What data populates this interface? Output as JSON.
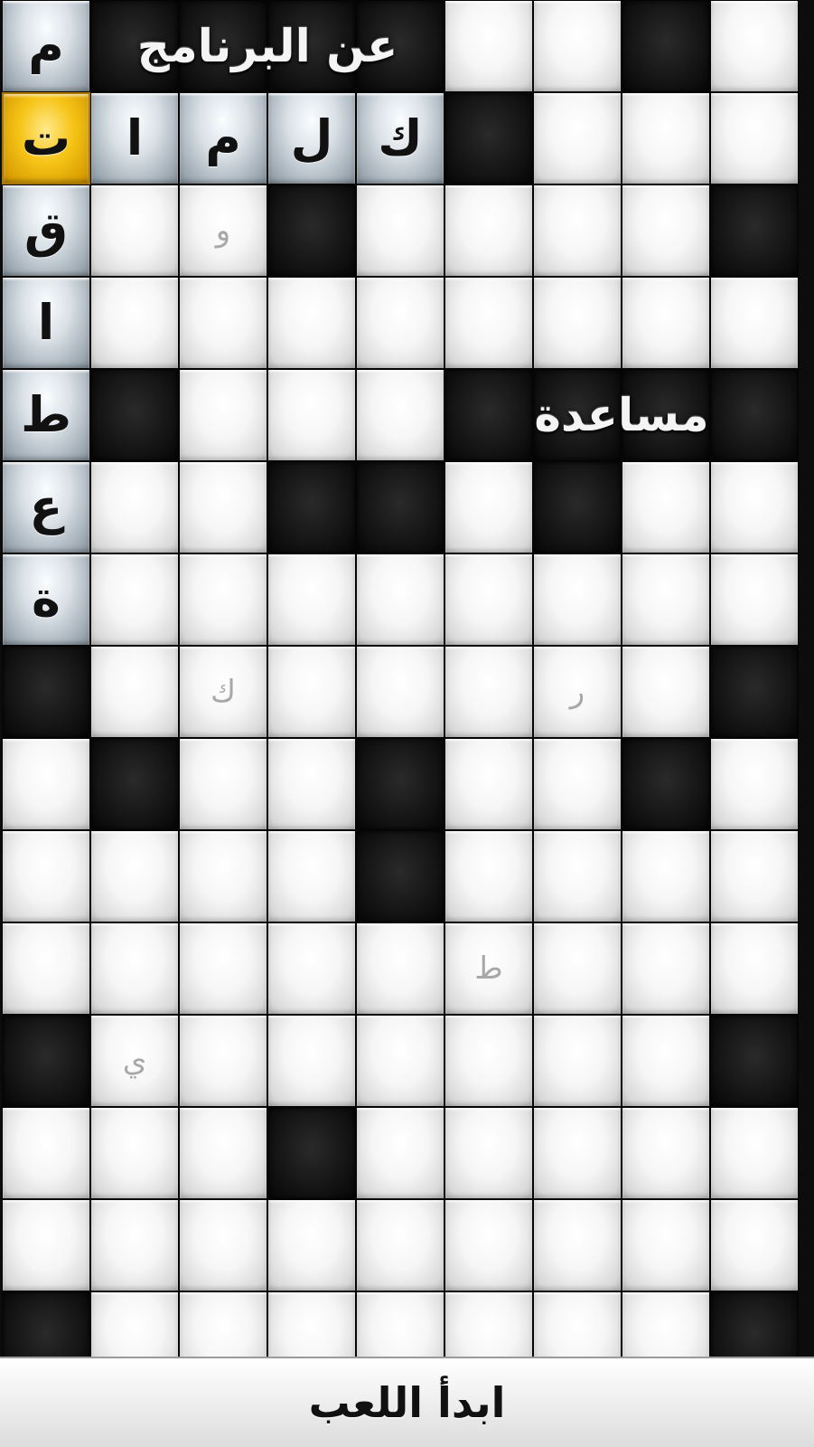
{
  "menu": {
    "about_label": "عن البرنامج",
    "help_label": "مساعدة",
    "start_label": "ابدأ اللعب"
  },
  "title_words": {
    "crosswords": [
      "ك",
      "ل",
      "م",
      "ا",
      "ت"
    ],
    "vertical": [
      "ق",
      "ا",
      "ط",
      "ع",
      "ة"
    ],
    "top_left": "م"
  },
  "hint_letters": [
    "و",
    "ك",
    "ر",
    "ط",
    "ي"
  ],
  "grid": {
    "cols": 9,
    "rows": 15,
    "layout": [
      "TBBBBWWBW",
      "GTTTTBWWW",
      "TWWBWWWWB",
      "TWWWWWWWW",
      "TBWWWBBBB",
      "TWWBBWBWW",
      "TWWWWWWWW",
      "BWWWWWWWB",
      "WBWWBWWBW",
      "WWWWBWWWW",
      "WWWWWWWWW",
      "BWWWWWWWB",
      "WWWBWWWWW",
      "WWWWWWWWW",
      "BWWWWWWWB"
    ]
  },
  "colors": {
    "highlight": "#f6c417",
    "title_tile": "#c2ccd4",
    "white_tile": "#f6f6f6",
    "black_tile": "#141414"
  }
}
